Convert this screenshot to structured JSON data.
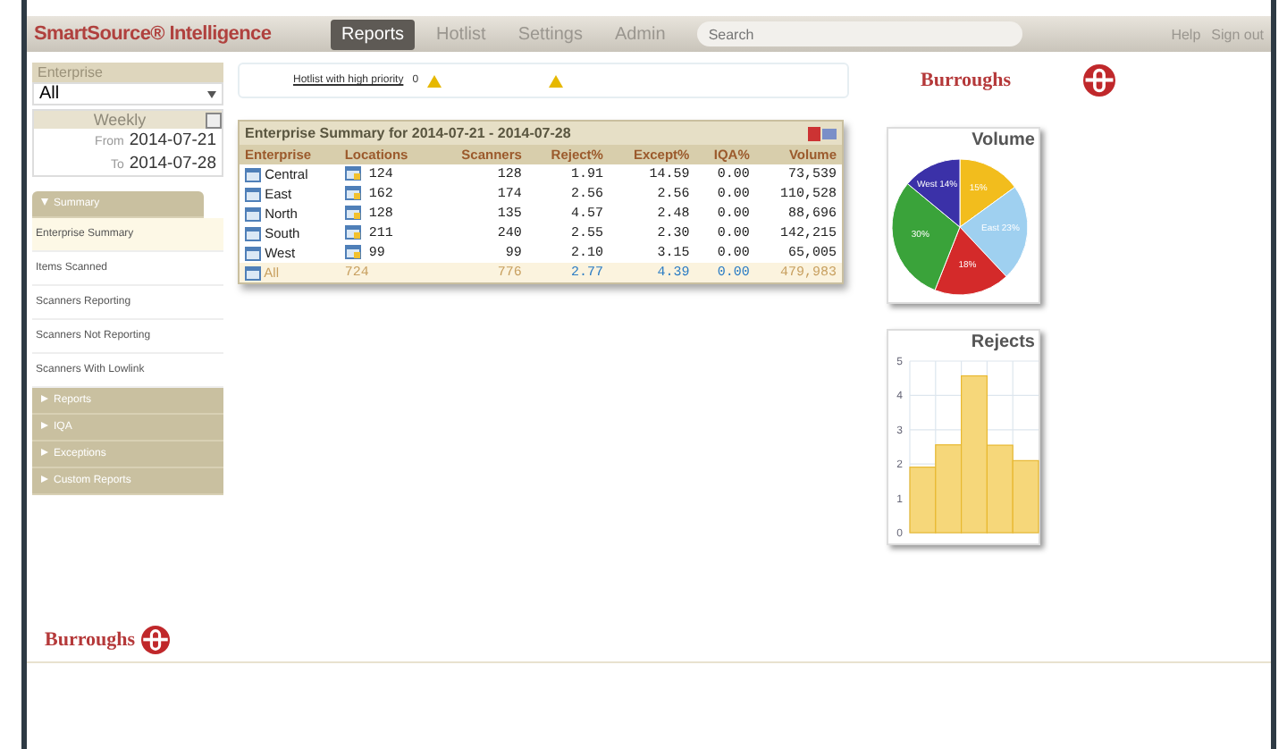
{
  "header": {
    "brand": "SmartSource® Intelligence",
    "tabs": [
      {
        "label": "Reports",
        "selected": true
      },
      {
        "label": "Hotlist",
        "selected": false
      },
      {
        "label": "Settings",
        "selected": false
      },
      {
        "label": "Admin",
        "selected": false
      }
    ],
    "search": {
      "placeholder": "Search"
    },
    "links": [
      "Help",
      "Sign out"
    ]
  },
  "sidebar": {
    "enterprise_label": "Enterprise",
    "enterprise_value": "All",
    "period": "Weekly",
    "from_label": "From",
    "from": "2014-07-21",
    "to_label": "To",
    "to": "2014-07-28",
    "sections": [
      {
        "label": "Summary",
        "expanded": true,
        "items": [
          {
            "label": "Enterprise Summary",
            "selected": true
          },
          {
            "label": "Items Scanned",
            "selected": false
          },
          {
            "label": "Scanners Reporting",
            "selected": false
          },
          {
            "label": "Scanners Not Reporting",
            "selected": false
          },
          {
            "label": "Scanners With Lowlink",
            "selected": false
          }
        ]
      },
      {
        "label": "Reports",
        "expanded": false
      },
      {
        "label": "IQA",
        "expanded": false
      },
      {
        "label": "Exceptions",
        "expanded": false
      },
      {
        "label": "Custom Reports",
        "expanded": false
      }
    ],
    "logo": "Burroughs"
  },
  "alerts": {
    "hotlist_link": "Hotlist with high priority",
    "hotlist_count": "0"
  },
  "logo": "Burroughs",
  "table": {
    "title": "Enterprise Summary for 2014-07-21 - 2014-07-28",
    "columns": [
      "Enterprise",
      "Locations",
      "Scanners",
      "Reject%",
      "Except%",
      "IQA%",
      "Volume"
    ],
    "rows": [
      {
        "cells": [
          "Central",
          "124",
          "128",
          "1.91",
          "14.59",
          "0.00",
          "73,539"
        ]
      },
      {
        "cells": [
          "East",
          "162",
          "174",
          "2.56",
          "2.56",
          "0.00",
          "110,528"
        ]
      },
      {
        "cells": [
          "North",
          "128",
          "135",
          "4.57",
          "2.48",
          "0.00",
          "88,696"
        ]
      },
      {
        "cells": [
          "South",
          "211",
          "240",
          "2.55",
          "2.30",
          "0.00",
          "142,215"
        ]
      },
      {
        "cells": [
          "West",
          "99",
          "99",
          "2.10",
          "3.15",
          "0.00",
          "65,005"
        ]
      }
    ],
    "total": [
      "All",
      "724",
      "776",
      "2.77",
      "4.39",
      "0.00",
      "479,983"
    ]
  },
  "volume_chart": {
    "chart_data": {
      "type": "pie",
      "title": "Volume",
      "values": [
        15,
        23,
        18,
        30,
        14
      ],
      "colors": [
        "#f2bd1d",
        "#9fd0f0",
        "#d42a2a",
        "#3aa33a",
        "#3b31a8"
      ],
      "value_labels": [
        "15%",
        "East 23%",
        "18%",
        "30%",
        "West 14%"
      ]
    }
  },
  "rejects_chart": {
    "chart_data": {
      "type": "bar",
      "title": "Rejects",
      "series": [
        {
          "color": "#f6d77a",
          "values": [
            1.91,
            2.56,
            4.57,
            2.55,
            2.1
          ]
        }
      ],
      "ylim": [
        0,
        5
      ],
      "yticks": [
        0,
        1,
        2,
        3,
        4,
        5
      ],
      "grid": true
    }
  }
}
